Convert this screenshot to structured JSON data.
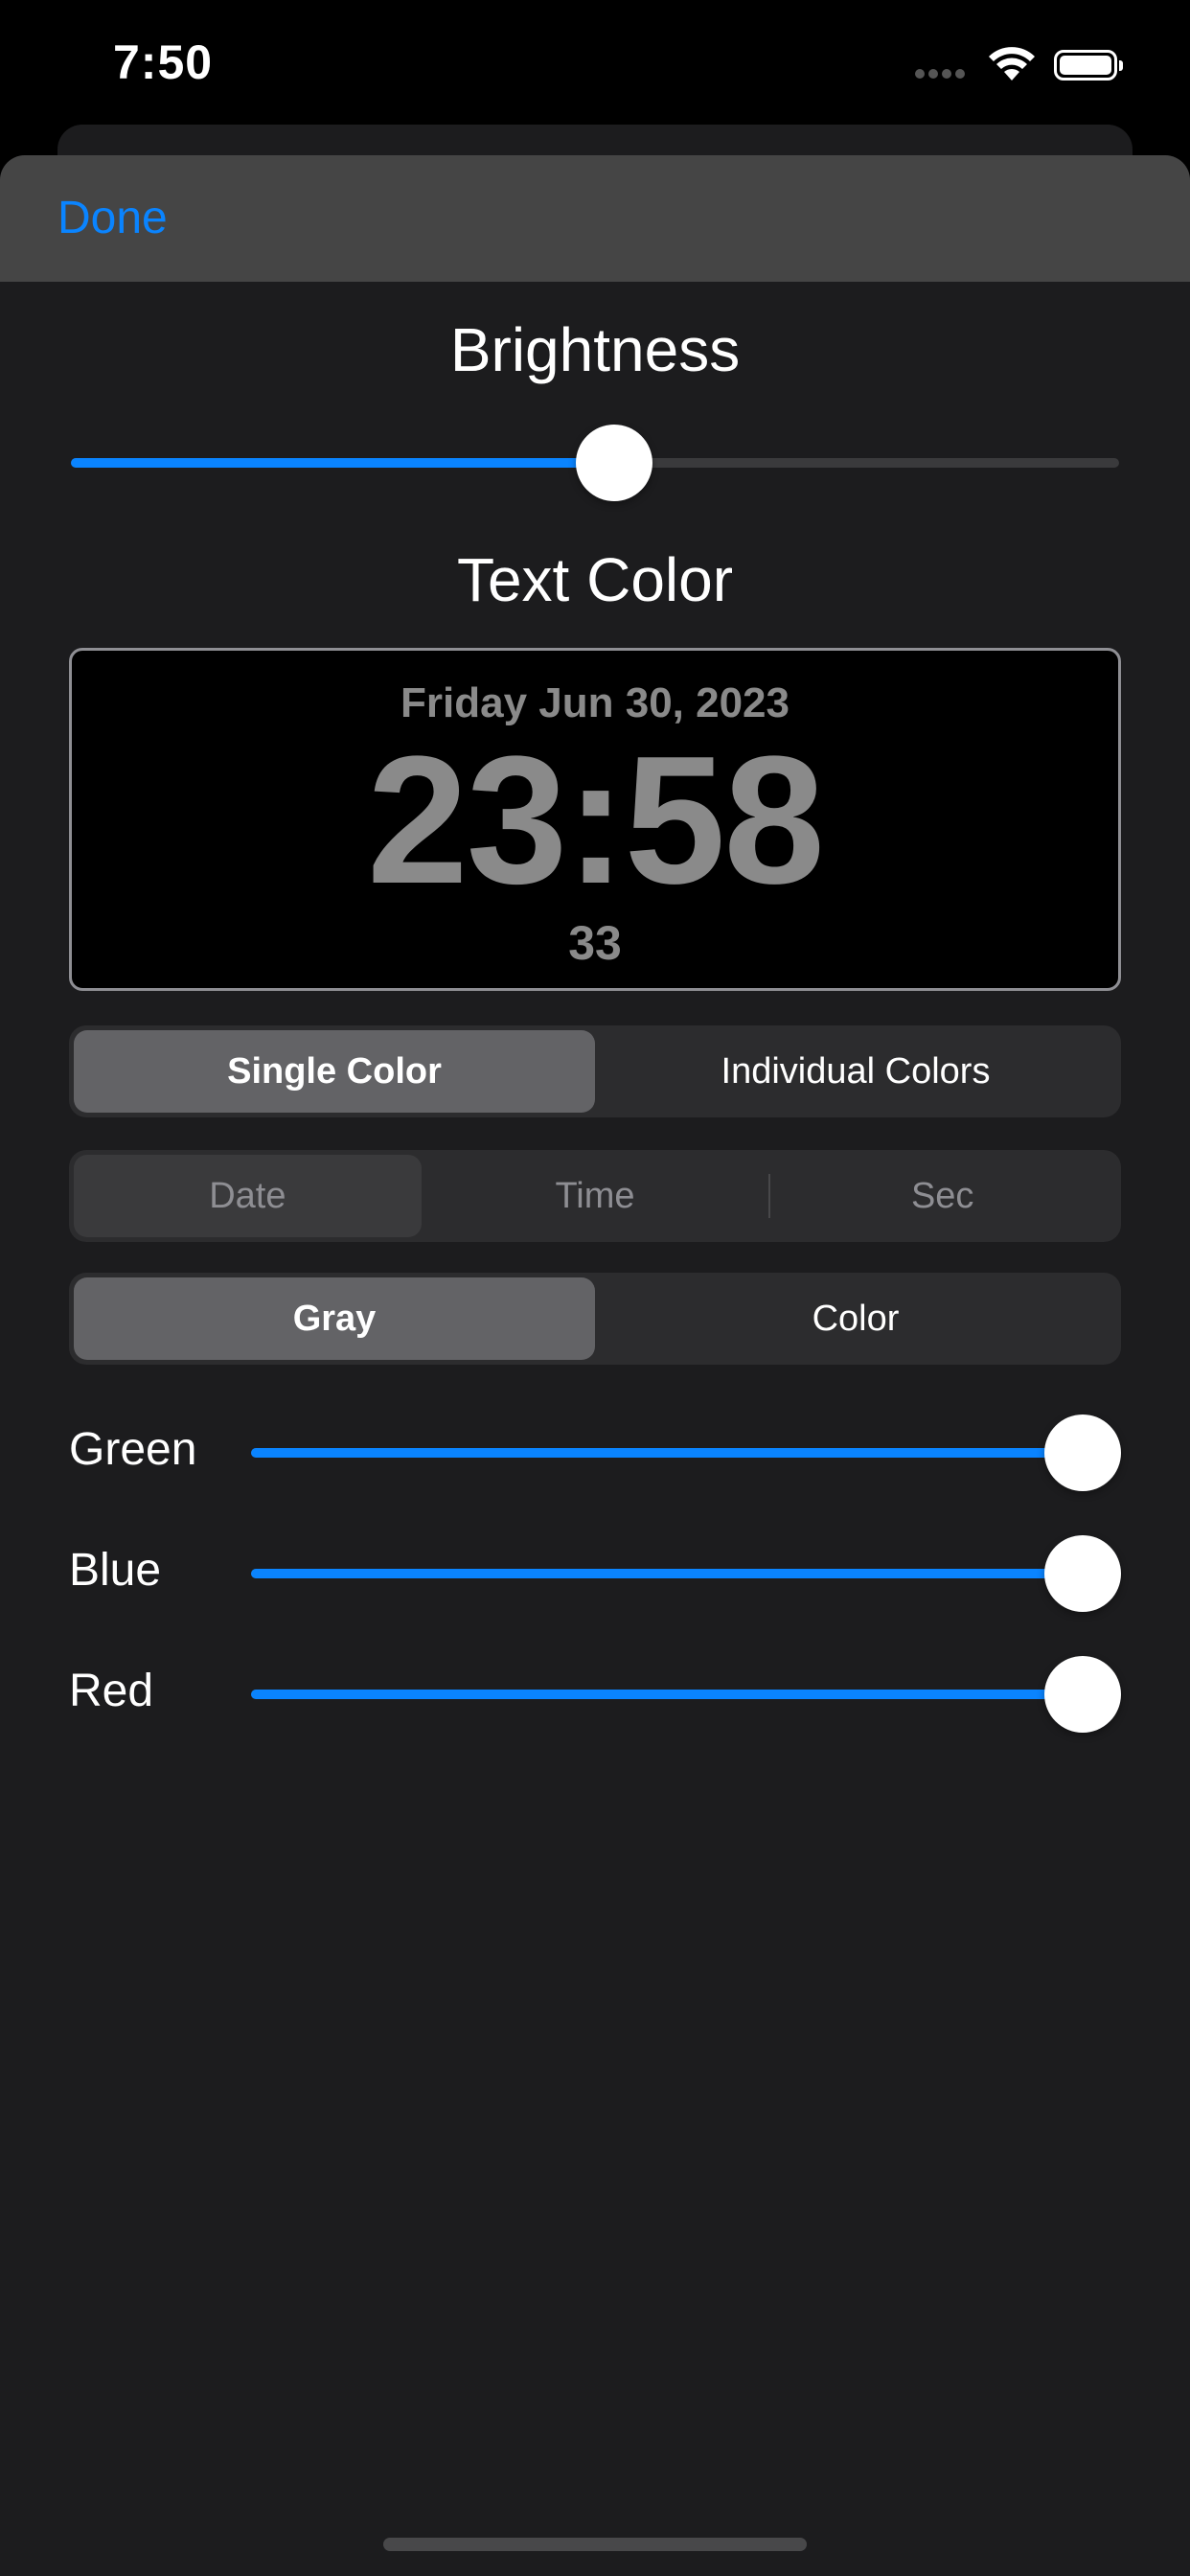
{
  "status_bar": {
    "time": "7:50",
    "signal_icon": "signal-icon",
    "wifi_icon": "wifi-icon",
    "battery_icon": "battery-icon"
  },
  "nav": {
    "done_label": "Done"
  },
  "brightness": {
    "title": "Brightness",
    "value": 0.52
  },
  "text_color": {
    "title": "Text Color"
  },
  "preview": {
    "date": "Friday Jun 30, 2023",
    "time": "23:58",
    "seconds": "33",
    "text_color": "#8a8a8a"
  },
  "color_mode": {
    "options": [
      "Single Color",
      "Individual Colors"
    ],
    "selected": "Single Color"
  },
  "component": {
    "options": [
      "Date",
      "Time",
      "Sec"
    ],
    "selected": "Date",
    "enabled": false
  },
  "palette": {
    "options": [
      "Gray",
      "Color"
    ],
    "selected": "Gray"
  },
  "channels": [
    {
      "label": "Green",
      "value": 1.0
    },
    {
      "label": "Blue",
      "value": 1.0
    },
    {
      "label": "Red",
      "value": 1.0
    }
  ],
  "colors": {
    "accent": "#0a84ff",
    "sheet": "#1c1c1e",
    "nav": "#454545"
  }
}
